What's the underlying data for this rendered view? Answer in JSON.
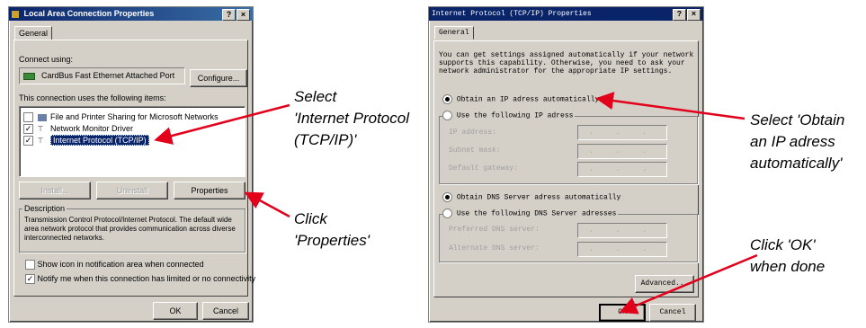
{
  "lac": {
    "title": "Local Area Connection Properties",
    "help": "?",
    "close": "×",
    "tab": "General",
    "connect_using": "Connect using:",
    "adapter": "CardBus Fast Ethernet Attached Port",
    "configure": "Configure...",
    "uses_label": "This connection uses the following items:",
    "items": [
      {
        "label": "File and Printer Sharing for Microsoft Networks",
        "checked": false
      },
      {
        "label": "Network Monitor Driver",
        "checked": true
      },
      {
        "label": "Internet Protocol (TCP/IP)",
        "checked": true
      }
    ],
    "install": "Install...",
    "uninstall": "Uninstall",
    "properties": "Properties",
    "description_label": "Description",
    "description": "Transmission Control Protocol/Internet Protocol. The default wide area network protocol that provides communication across diverse interconnected networks.",
    "show_icon": "Show icon in notification area when connected",
    "notify": "Notify me when this connection has limited or no connectivity",
    "ok": "OK",
    "cancel": "Cancel"
  },
  "tcp": {
    "title": "Internet Protocol (TCP/IP) Properties",
    "help": "?",
    "close": "×",
    "tab": "General",
    "intro": "You can get settings assigned automatically if your network supports this capability. Otherwise, you need to ask your network administrator for the appropriate IP settings.",
    "obtain_ip": "Obtain an IP adress automatically",
    "use_ip": "Use the following IP adress",
    "ip_address": "IP address:",
    "subnet": "Subnet mask:",
    "gateway": "Default gateway:",
    "obtain_dns": "Obtain DNS Server adress automatically",
    "use_dns": "Use the following DNS Server adresses",
    "pref_dns": "Preferred DNS server:",
    "alt_dns": "Alternate DNS server:",
    "advanced": "Advanced...",
    "ok": "OK",
    "cancel": "Cancel",
    "dots": ". . ."
  },
  "annotations": {
    "select_tcp_1": "Select",
    "select_tcp_2": "'Internet Protocol",
    "select_tcp_3": "(TCP/IP)'",
    "click_prop_1": "Click",
    "click_prop_2": "'Properties'",
    "obtain_1": "Select 'Obtain",
    "obtain_2": "an IP adress",
    "obtain_3": "automatically'",
    "ok_1": "Click 'OK'",
    "ok_2": "when done"
  },
  "colors": {
    "arrow": "#e3001b",
    "titlebar": "#0a246a",
    "selection": "#0a246a"
  }
}
